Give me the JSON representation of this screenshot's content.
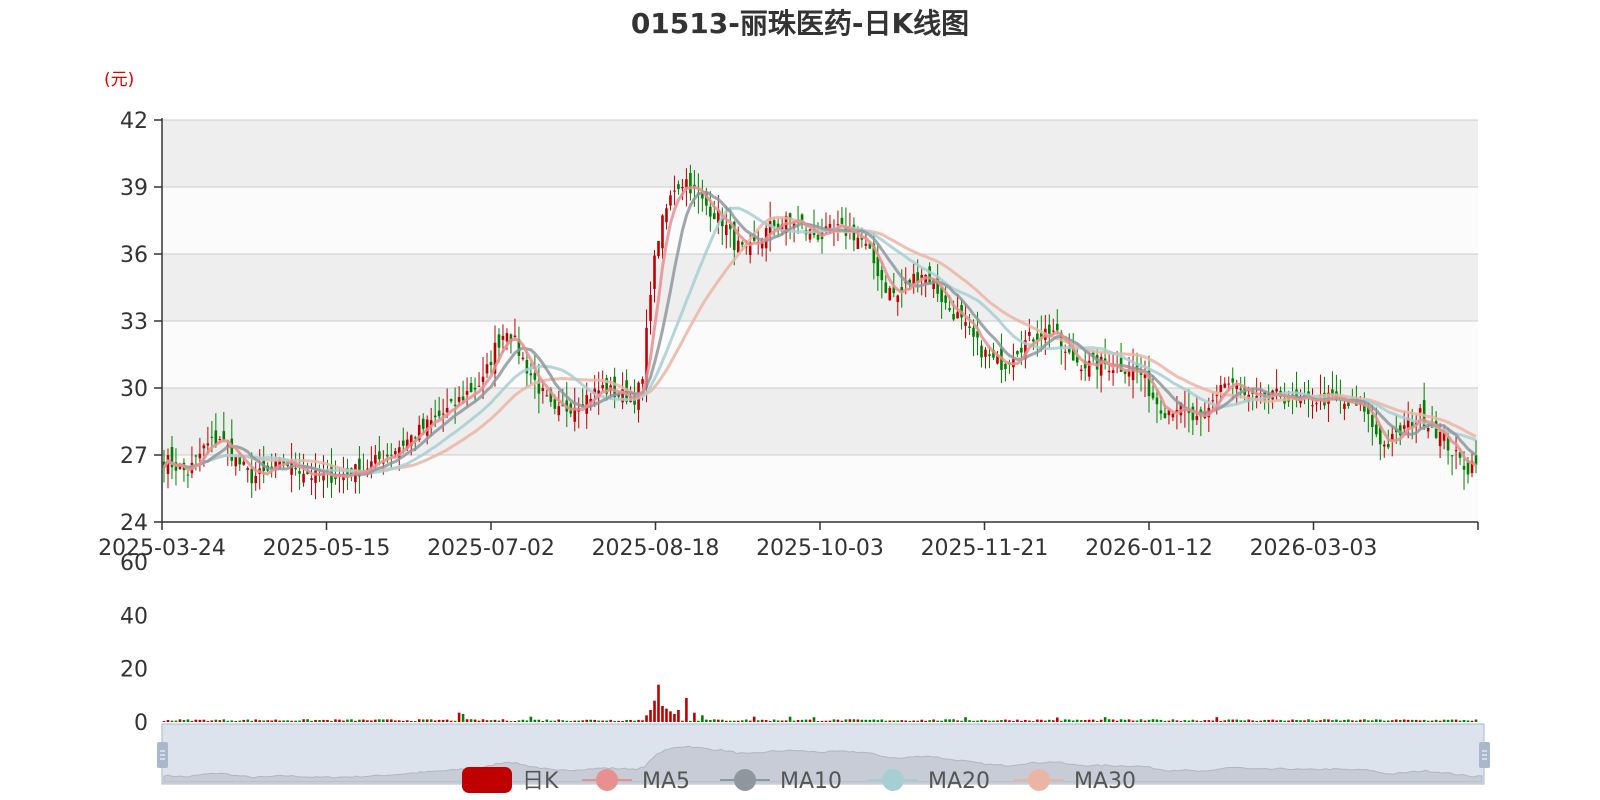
{
  "chart_data": {
    "type": "candlestick",
    "title": "01513-丽珠医药-日K线图",
    "y_unit": "(元)",
    "ylim": [
      24,
      42
    ],
    "y_ticks": [
      24,
      27,
      30,
      33,
      36,
      39,
      42
    ],
    "x_tick_labels": [
      "2025-03-24",
      "2025-05-15",
      "2025-07-02",
      "2025-08-18",
      "2025-10-03",
      "2025-11-21",
      "2026-01-12",
      "2026-03-03"
    ],
    "volume_ylim": [
      0,
      60
    ],
    "volume_ticks": [
      0,
      20,
      40,
      60
    ],
    "legend": [
      "日K",
      "MA5",
      "MA10",
      "MA20",
      "MA30"
    ],
    "colors": {
      "up": "#c00000",
      "down": "#008000",
      "ma5": "#e88f8f",
      "ma10": "#8e969e",
      "ma20": "#a7cfd3",
      "ma30": "#eab5a3",
      "band_a": "#eeeeee",
      "band_b": "#fbfbfb"
    },
    "close_keypoints": [
      [
        0,
        26.8
      ],
      [
        3,
        26.5
      ],
      [
        6,
        26.2
      ],
      [
        10,
        27.3
      ],
      [
        14,
        27.8
      ],
      [
        18,
        26.8
      ],
      [
        22,
        26.0
      ],
      [
        26,
        26.2
      ],
      [
        30,
        26.7
      ],
      [
        34,
        26.4
      ],
      [
        38,
        26.0
      ],
      [
        44,
        26.1
      ],
      [
        50,
        26.4
      ],
      [
        56,
        27.0
      ],
      [
        62,
        27.8
      ],
      [
        68,
        28.6
      ],
      [
        72,
        29.1
      ],
      [
        76,
        29.8
      ],
      [
        80,
        30.3
      ],
      [
        83,
        31.8
      ],
      [
        86,
        32.7
      ],
      [
        88,
        32.0
      ],
      [
        91,
        30.9
      ],
      [
        94,
        30.0
      ],
      [
        98,
        28.8
      ],
      [
        102,
        29.2
      ],
      [
        106,
        29.6
      ],
      [
        110,
        30.0
      ],
      [
        114,
        29.7
      ],
      [
        118,
        29.6
      ],
      [
        120,
        30.3
      ],
      [
        122,
        34.5
      ],
      [
        124,
        36.8
      ],
      [
        126,
        38.0
      ],
      [
        128,
        39.0
      ],
      [
        131,
        39.3
      ],
      [
        134,
        38.5
      ],
      [
        137,
        38.0
      ],
      [
        140,
        37.5
      ],
      [
        143,
        36.5
      ],
      [
        146,
        36.0
      ],
      [
        149,
        36.6
      ],
      [
        152,
        37.2
      ],
      [
        155,
        37.4
      ],
      [
        158,
        37.5
      ],
      [
        161,
        37.0
      ],
      [
        165,
        36.8
      ],
      [
        168,
        37.1
      ],
      [
        172,
        37.0
      ],
      [
        175,
        36.6
      ],
      [
        178,
        35.6
      ],
      [
        181,
        34.5
      ],
      [
        184,
        34.1
      ],
      [
        187,
        34.8
      ],
      [
        190,
        35.2
      ],
      [
        193,
        34.7
      ],
      [
        196,
        33.7
      ],
      [
        199,
        33.2
      ],
      [
        202,
        32.4
      ],
      [
        205,
        31.7
      ],
      [
        208,
        31.2
      ],
      [
        211,
        31.1
      ],
      [
        214,
        31.8
      ],
      [
        217,
        32.2
      ],
      [
        220,
        32.5
      ],
      [
        223,
        32.6
      ],
      [
        226,
        31.5
      ],
      [
        229,
        31.2
      ],
      [
        232,
        31.0
      ],
      [
        235,
        31.1
      ],
      [
        238,
        31.0
      ],
      [
        242,
        30.9
      ],
      [
        245,
        30.6
      ],
      [
        248,
        29.6
      ],
      [
        251,
        29.0
      ],
      [
        254,
        29.2
      ],
      [
        257,
        28.7
      ],
      [
        260,
        28.4
      ],
      [
        262,
        29.0
      ],
      [
        265,
        30.2
      ],
      [
        268,
        30.2
      ],
      [
        271,
        29.6
      ],
      [
        274,
        29.4
      ],
      [
        277,
        29.5
      ],
      [
        280,
        29.7
      ],
      [
        283,
        29.4
      ],
      [
        286,
        29.3
      ],
      [
        289,
        29.5
      ],
      [
        292,
        29.5
      ],
      [
        295,
        29.3
      ],
      [
        298,
        29.2
      ],
      [
        301,
        29.1
      ],
      [
        303,
        28.3
      ],
      [
        306,
        27.4
      ],
      [
        309,
        27.8
      ],
      [
        312,
        28.4
      ],
      [
        315,
        28.8
      ],
      [
        318,
        28.3
      ],
      [
        321,
        27.7
      ],
      [
        324,
        26.9
      ],
      [
        327,
        26.4
      ],
      [
        329,
        26.9
      ]
    ],
    "volume_spikes": [
      [
        74,
        3.5
      ],
      [
        75,
        3.0
      ],
      [
        92,
        2.0
      ],
      [
        121,
        2.5
      ],
      [
        122,
        4.5
      ],
      [
        123,
        8.0
      ],
      [
        124,
        14.0
      ],
      [
        125,
        6.0
      ],
      [
        126,
        5.0
      ],
      [
        127,
        4.0
      ],
      [
        128,
        3.0
      ],
      [
        129,
        4.5
      ],
      [
        131,
        9.0
      ],
      [
        133,
        3.5
      ],
      [
        135,
        2.5
      ],
      [
        148,
        2.0
      ],
      [
        157,
        2.0
      ],
      [
        163,
        1.8
      ],
      [
        201,
        1.8
      ],
      [
        224,
        1.7
      ],
      [
        236,
        1.8
      ],
      [
        264,
        1.8
      ]
    ],
    "dataZoom": {
      "range": [
        0,
        100
      ]
    }
  }
}
